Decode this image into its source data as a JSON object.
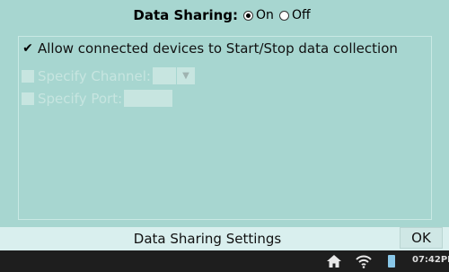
{
  "header": {
    "title": "Data Sharing:",
    "option_on": "On",
    "option_off": "Off",
    "selected": "On"
  },
  "options": {
    "allow_label": "Allow connected devices to Start/Stop data collection",
    "allow_checked": true,
    "channel_label": "Specify Channel:",
    "channel_value": "",
    "port_label": "Specify Port:",
    "port_value": ""
  },
  "footer": {
    "title": "Data Sharing Settings",
    "ok_label": "OK"
  },
  "statusbar": {
    "time": "07:42PM",
    "icons": [
      "home-icon",
      "wifi-icon",
      "battery-icon"
    ]
  },
  "colors": {
    "background": "#a7d6d0",
    "footer": "#d9efee",
    "statusbar": "#1e1e1e"
  }
}
